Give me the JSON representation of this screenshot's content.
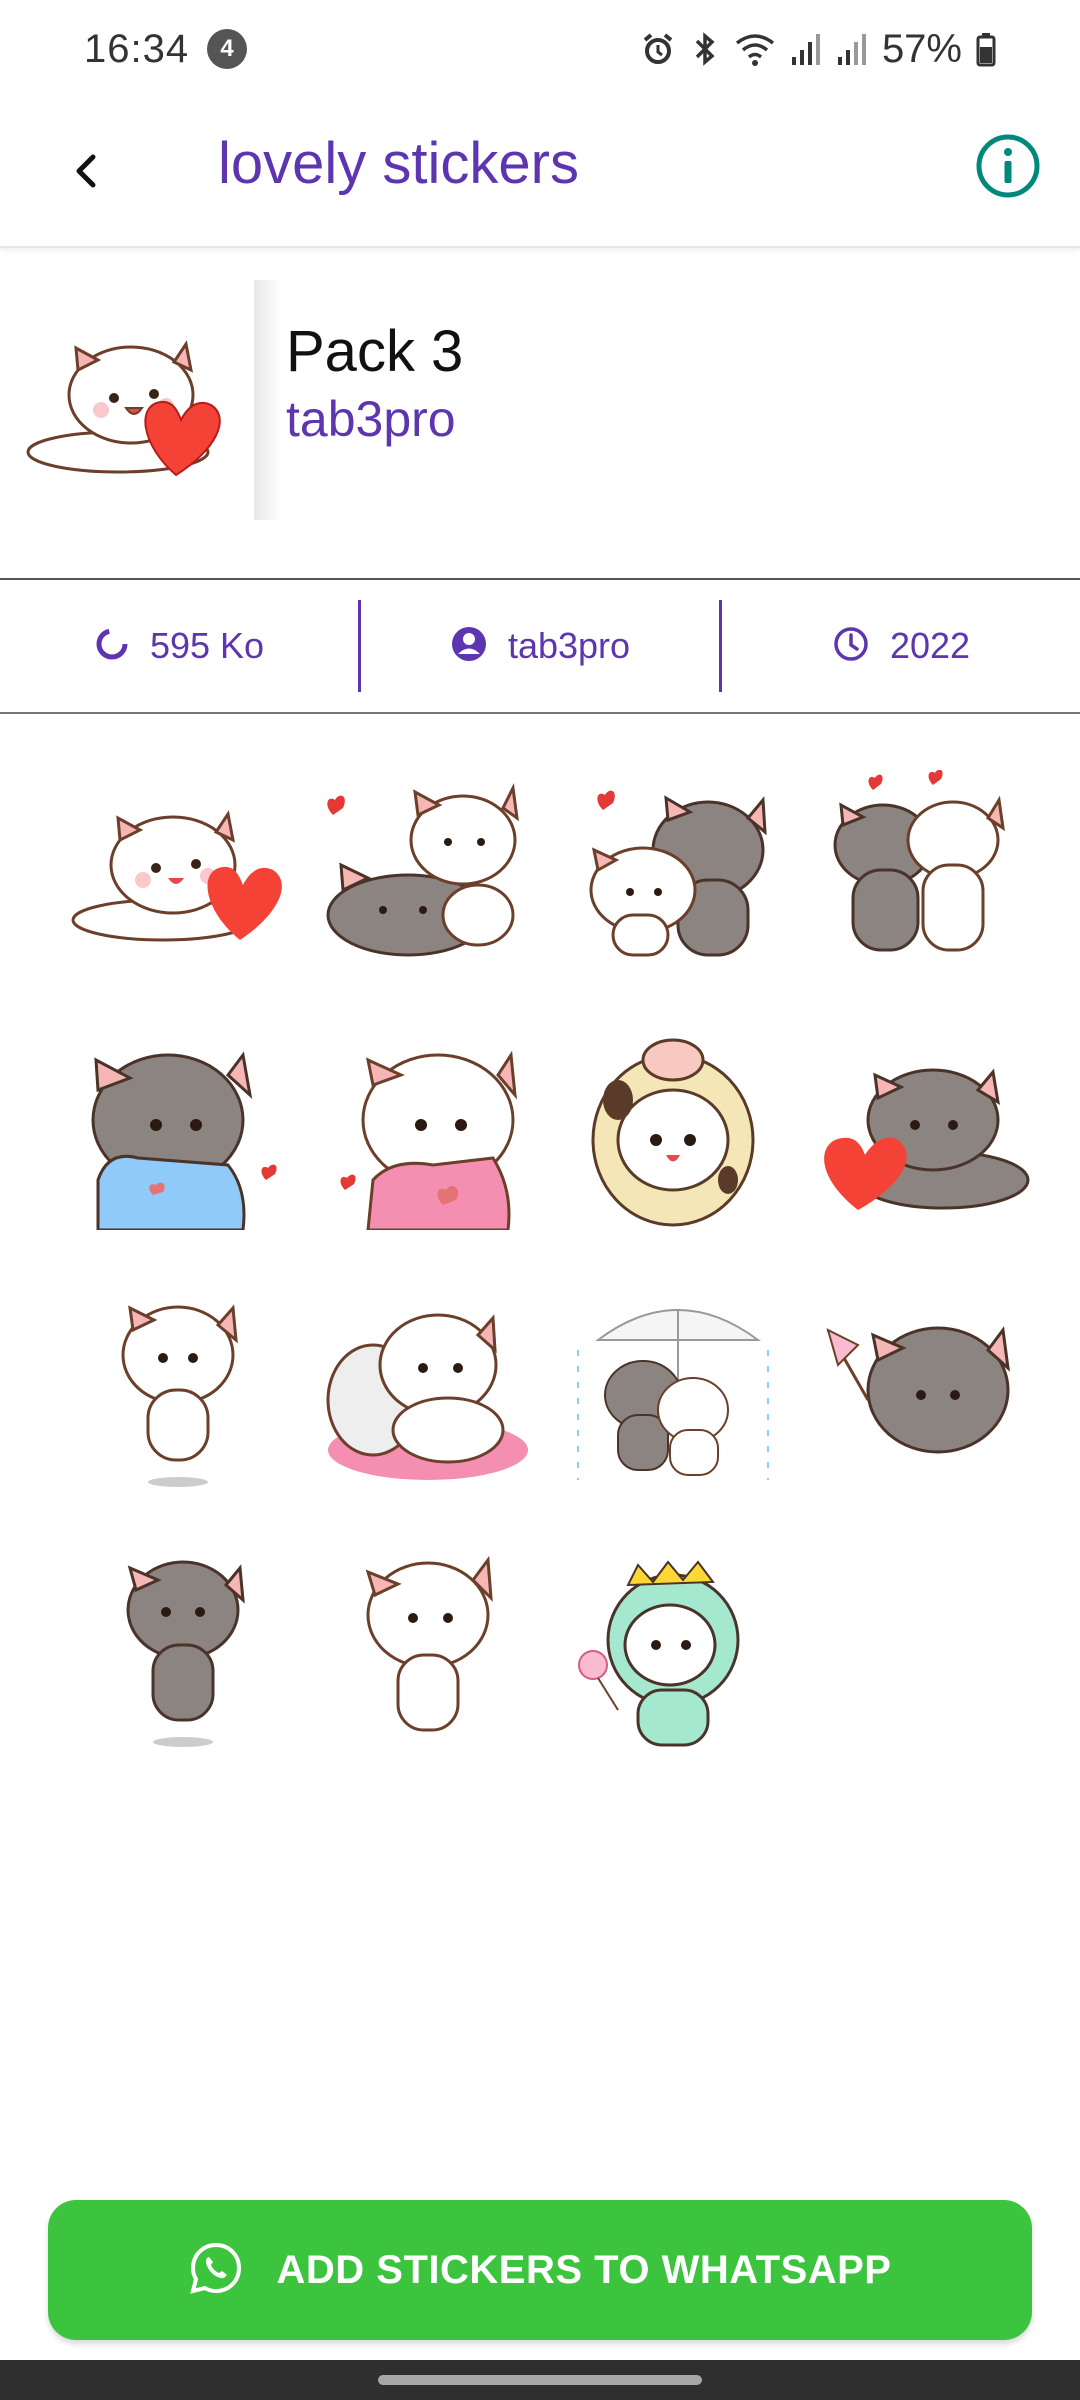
{
  "status_bar": {
    "time": "16:34",
    "notification_count": "4",
    "battery": "57%"
  },
  "app_bar": {
    "title": "lovely stickers",
    "back_icon": "back-arrow-icon",
    "info_icon": "info-icon"
  },
  "pack": {
    "name": "Pack 3",
    "publisher": "tab3pro"
  },
  "info": {
    "size": "595 Ko",
    "author": "tab3pro",
    "year": "2022"
  },
  "stickers": [
    {
      "desc": "white-cat-lying-with-heart"
    },
    {
      "desc": "white-cat-on-grey-cat"
    },
    {
      "desc": "grey-cat-hugging-white-cat"
    },
    {
      "desc": "cats-in-love"
    },
    {
      "desc": "grey-cat-blue-shirt"
    },
    {
      "desc": "white-cat-pink-shirt"
    },
    {
      "desc": "cow-costume-cat"
    },
    {
      "desc": "grey-cat-with-heart"
    },
    {
      "desc": "white-cat-jumping"
    },
    {
      "desc": "white-cat-pillow"
    },
    {
      "desc": "cats-under-umbrella"
    },
    {
      "desc": "grey-cat-flag"
    },
    {
      "desc": "grey-cat-walking"
    },
    {
      "desc": "white-cat-confused"
    },
    {
      "desc": "dino-costume-cat"
    }
  ],
  "add_button": {
    "label": "ADD STICKERS TO WHATSAPP",
    "icon": "whatsapp-icon"
  },
  "colors": {
    "accent": "#5e35b1",
    "button": "#3cc43f",
    "info_icon": "#00897b"
  }
}
